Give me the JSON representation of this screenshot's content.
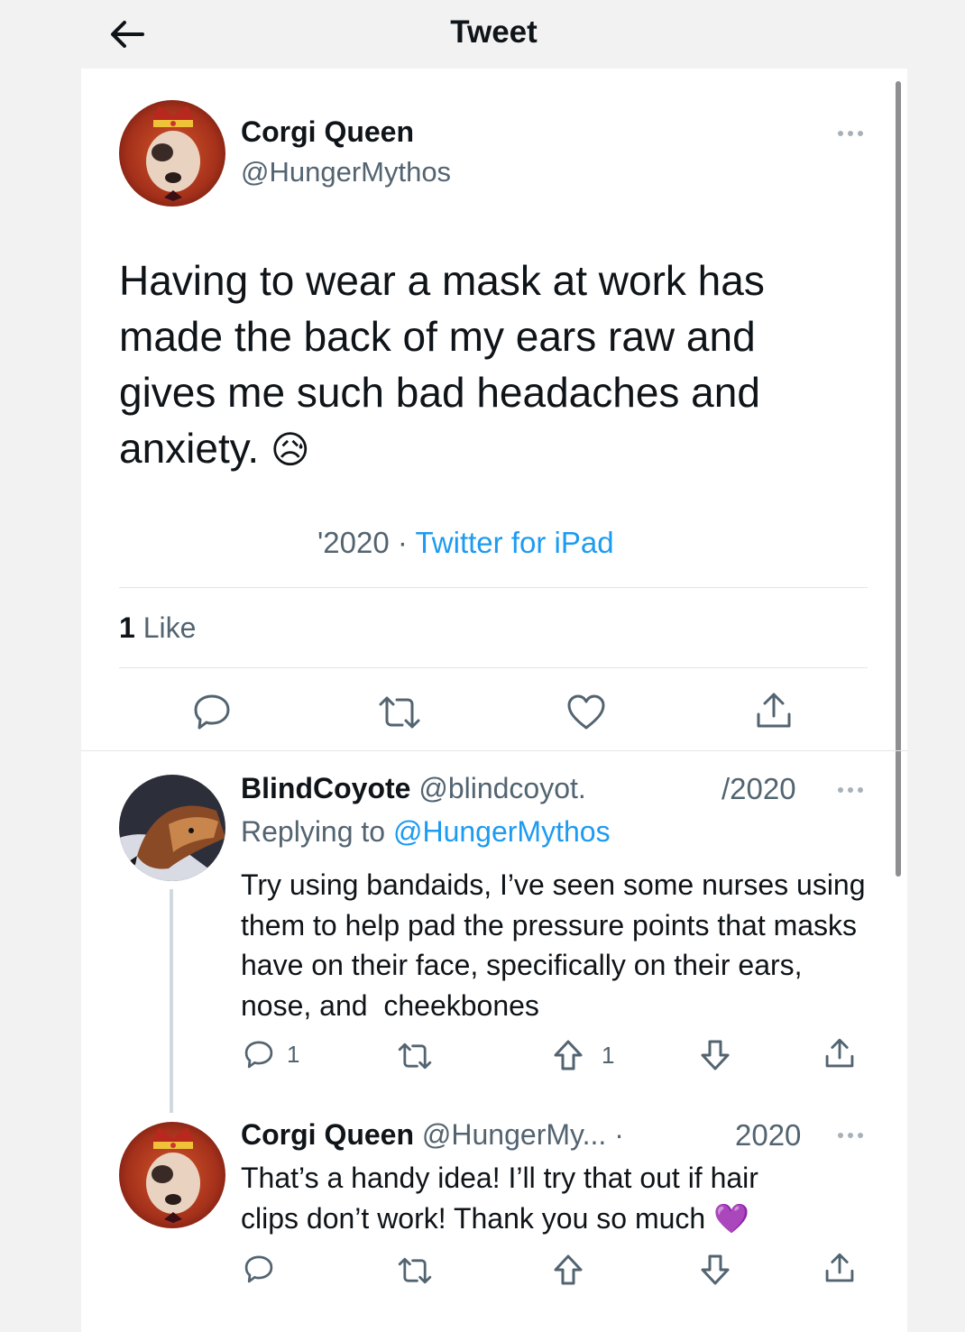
{
  "header": {
    "title": "Tweet",
    "back_icon": "arrow-left-icon"
  },
  "main_tweet": {
    "author_name": "Corgi Queen",
    "author_handle": "@HungerMythos",
    "text": "Having to wear a mask at work has made the back of my ears raw and gives me such bad headaches and anxiety.",
    "emoji": "😥",
    "date": "'2020",
    "separator": "·",
    "source": "Twitter for iPad",
    "likes_count": "1",
    "likes_label": "Like",
    "actions": [
      "reply-icon",
      "retweet-icon",
      "heart-icon",
      "share-icon"
    ]
  },
  "reply_1": {
    "author_name": "BlindCoyote",
    "author_handle": "@blindcoyot.",
    "date": "/2020",
    "replying_prefix": "Replying to",
    "replying_handle": "@HungerMythos",
    "text": "Try using bandaids, I’ve seen some nurses using them to help pad the pressure points that masks have on their face, specifically on their ears, nose, and  cheekbones",
    "reply_count": "1",
    "upvote_count": "1",
    "actions": [
      "reply-icon",
      "retweet-icon",
      "upvote-icon",
      "downvote-icon",
      "share-icon"
    ]
  },
  "reply_2": {
    "author_name": "Corgi Queen",
    "author_handle": "@HungerMy... ·",
    "date": "2020",
    "text": "That’s a handy idea! I’ll try that out if hair clips don’t work! Thank you so much",
    "emoji": "💜",
    "actions": [
      "reply-icon",
      "retweet-icon",
      "upvote-icon",
      "downvote-icon",
      "share-icon"
    ]
  },
  "colors": {
    "accent": "#1d9bf0",
    "text": "#0f1419",
    "muted": "#536471",
    "background": "#f2f2f3"
  }
}
